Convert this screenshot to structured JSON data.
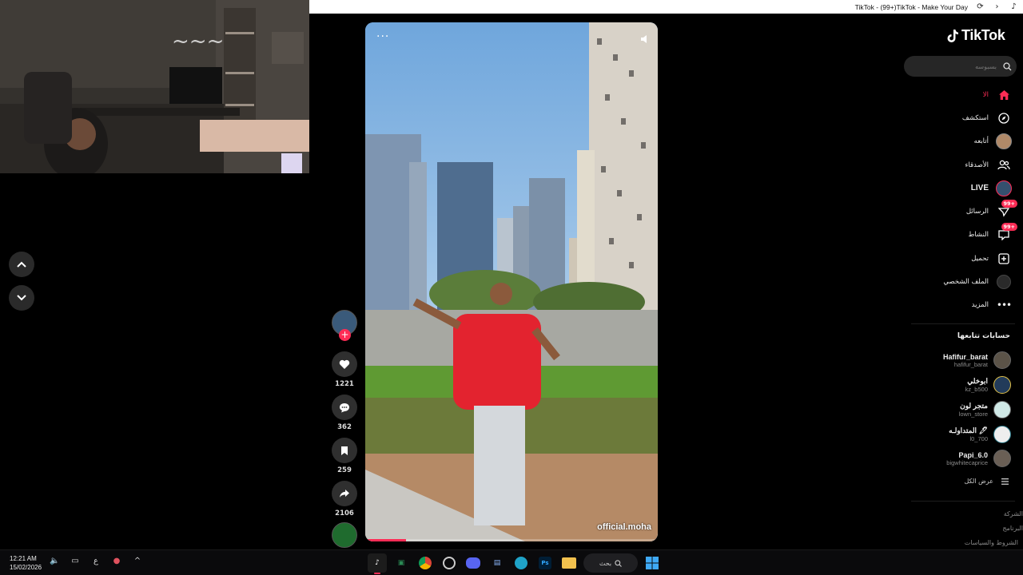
{
  "window": {
    "title": "TikTok - (99+)TikTok - Make Your Day"
  },
  "sidebar": {
    "logo_text": "TikTok",
    "search_placeholder": "بسبوسه",
    "nav": [
      {
        "label": "الا",
        "icon": "home-icon",
        "active": true
      },
      {
        "label": "استكشف",
        "icon": "compass-icon"
      },
      {
        "label": "أتابعه",
        "icon": "following-avatar-icon"
      },
      {
        "label": "الأصدقاء",
        "icon": "friends-icon"
      },
      {
        "label": "LIVE",
        "icon": "live-icon"
      },
      {
        "label": "الرسائل",
        "icon": "messages-icon",
        "badge": "99+"
      },
      {
        "label": "النشاط",
        "icon": "activity-icon",
        "badge": "99+"
      },
      {
        "label": "تحميل",
        "icon": "upload-icon"
      },
      {
        "label": "الملف الشخصي",
        "icon": "profile-avatar-icon"
      },
      {
        "label": "المزيد",
        "icon": "more-dots-icon"
      }
    ],
    "following_title": "حسابات تتابعها",
    "following": [
      {
        "name": "Hafifur_barat",
        "handle": "hafifur_barat"
      },
      {
        "name": "ابوخلي",
        "handle": "kz_b500"
      },
      {
        "name": "متجر لون",
        "handle": "lown_store"
      },
      {
        "name": "المتداولـه 🖊",
        "handle": "l0_700"
      },
      {
        "name": "Papi_6.0",
        "handle": "bigwhitecaprice"
      }
    ],
    "see_all": "عرض الكل",
    "footer": [
      "الشركة",
      "البرنامج",
      "الشروط والسياسات"
    ]
  },
  "video": {
    "watermark": "official.moha",
    "progress": 0.14
  },
  "actions": {
    "likes": "1221",
    "comments": "362",
    "saves": "259",
    "shares": "2106"
  },
  "taskbar": {
    "time": "12:21 AM",
    "date": "15/02/2026",
    "lang": "ع",
    "search_label": "بحث",
    "apps": [
      "tiktok",
      "excel",
      "chrome",
      "obs",
      "discord",
      "task-view",
      "edge",
      "photoshop",
      "explorer"
    ]
  },
  "colors": {
    "accent": "#fe2c55",
    "background": "#000000"
  }
}
